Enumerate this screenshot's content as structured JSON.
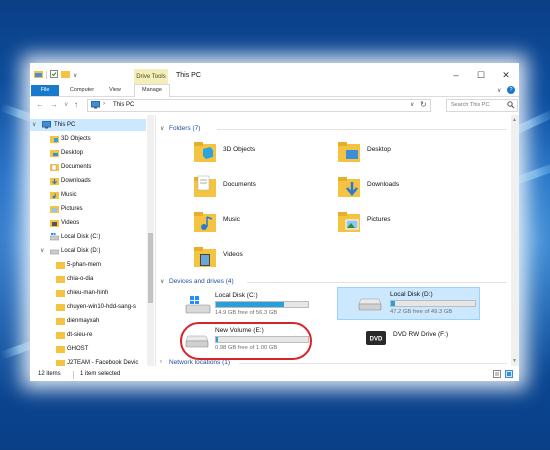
{
  "window": {
    "title": "This PC",
    "contextual_tab": "Drive Tools",
    "qat_separator": "∨"
  },
  "ribbon": {
    "tabs": [
      "File",
      "Computer",
      "View",
      "Manage"
    ]
  },
  "address": {
    "path": "This PC",
    "search_placeholder": "Search This PC"
  },
  "sidebar": {
    "items": [
      {
        "label": "This PC",
        "icon": "computer-icon",
        "selected": true
      },
      {
        "label": "3D Objects",
        "icon": "folder-3d-icon"
      },
      {
        "label": "Desktop",
        "icon": "folder-desktop-icon"
      },
      {
        "label": "Documents",
        "icon": "folder-documents-icon"
      },
      {
        "label": "Downloads",
        "icon": "folder-downloads-icon"
      },
      {
        "label": "Music",
        "icon": "folder-music-icon"
      },
      {
        "label": "Pictures",
        "icon": "folder-pictures-icon"
      },
      {
        "label": "Videos",
        "icon": "folder-videos-icon"
      },
      {
        "label": "Local Disk (C:)",
        "icon": "drive-windows-icon"
      },
      {
        "label": "Local Disk (D:)",
        "icon": "drive-icon"
      },
      {
        "label": "5-phan-mem",
        "icon": "folder-icon"
      },
      {
        "label": "chia-o-dia",
        "icon": "folder-icon"
      },
      {
        "label": "chieu-man-hinh",
        "icon": "folder-icon"
      },
      {
        "label": "chuyen-win10-hdd-sang-s",
        "icon": "folder-icon"
      },
      {
        "label": "dienmayxah",
        "icon": "folder-icon"
      },
      {
        "label": "dt-sieu-re",
        "icon": "folder-icon"
      },
      {
        "label": "GHOST",
        "icon": "folder-icon"
      },
      {
        "label": "J2TEAM - Facebook Devic",
        "icon": "folder-icon"
      }
    ]
  },
  "folders": {
    "header": "Folders (7)",
    "items": [
      {
        "label": "3D Objects",
        "icon": "folder-3d-icon"
      },
      {
        "label": "Desktop",
        "icon": "folder-desktop-icon"
      },
      {
        "label": "Documents",
        "icon": "folder-documents-icon"
      },
      {
        "label": "Downloads",
        "icon": "folder-downloads-icon"
      },
      {
        "label": "Music",
        "icon": "folder-music-icon"
      },
      {
        "label": "Pictures",
        "icon": "folder-pictures-icon"
      },
      {
        "label": "Videos",
        "icon": "folder-videos-icon"
      }
    ]
  },
  "devices": {
    "header": "Devices and drives (4)",
    "items": [
      {
        "name": "Local Disk (C:)",
        "free": "14.9 GB free of 56.3 GB",
        "used_fraction": 0.735,
        "icon": "drive-windows-icon",
        "selected": false
      },
      {
        "name": "Local Disk (D:)",
        "free": "47.2 GB free of 49.3 GB",
        "used_fraction": 0.043,
        "icon": "drive-icon",
        "selected": true
      },
      {
        "name": "New Volume (E:)",
        "free": "0.98 GB free of 1.00 GB",
        "used_fraction": 0.02,
        "icon": "drive-icon",
        "selected": false
      },
      {
        "name": "DVD RW Drive (F:)",
        "free": "",
        "icon": "dvd-drive-icon",
        "selected": false
      }
    ]
  },
  "network": {
    "header": "Network locations (1)"
  },
  "status": {
    "items_count": "12 items",
    "selected": "1 item selected"
  },
  "colors": {
    "accent": "#1979ca",
    "selection": "#cce8ff",
    "section_header": "#1f4f9b",
    "drive_fill": "#26a0da",
    "annotation": "#d9232a"
  }
}
